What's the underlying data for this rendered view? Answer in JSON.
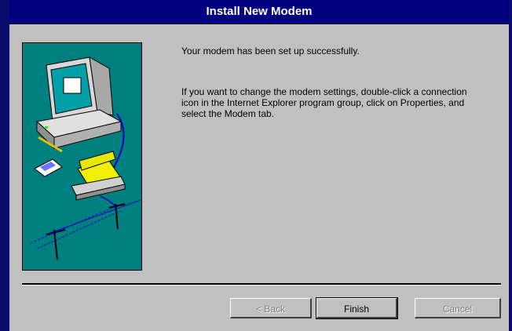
{
  "window": {
    "title": "Install New Modem"
  },
  "message": {
    "line1": "Your modem has been set up successfully.",
    "line2": "If you want to change the modem settings, double-click a connection icon in the Internet Explorer program group, click on Properties, and select the Modem tab."
  },
  "buttons": {
    "back": "< Back",
    "finish": "Finish",
    "cancel": "Cancel"
  },
  "colors": {
    "titlebar": "#000080",
    "panel": "#007f7f",
    "face": "#c0c0c0"
  }
}
